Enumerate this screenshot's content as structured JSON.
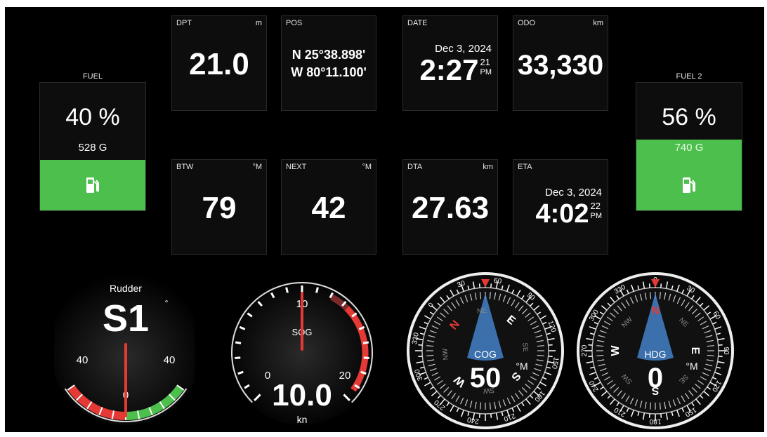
{
  "fuel1": {
    "title": "FUEL",
    "percent": "40 %",
    "gallons": "528 G",
    "level": 0.4
  },
  "fuel2": {
    "title": "FUEL 2",
    "percent": "56 %",
    "gallons": "740 G",
    "level": 0.56
  },
  "tiles": {
    "dpt": {
      "label": "DPT",
      "unit": "m",
      "value": "21.0"
    },
    "pos": {
      "label": "POS",
      "lat": "N 25°38.898'",
      "lon": "W 80°11.100'"
    },
    "date": {
      "label": "DATE",
      "date": "Dec 3, 2024",
      "time": "2:27",
      "sec": "21",
      "ampm": "PM"
    },
    "odo": {
      "label": "ODO",
      "unit": "km",
      "value": "33,330"
    },
    "btw": {
      "label": "BTW",
      "unit": "°M",
      "value": "79"
    },
    "next": {
      "label": "NEXT",
      "unit": "°M",
      "value": "42"
    },
    "dta": {
      "label": "DTA",
      "unit": "km",
      "value": "27.63"
    },
    "eta": {
      "label": "ETA",
      "date": "Dec 3, 2024",
      "time": "4:02",
      "sec": "22",
      "ampm": "PM"
    }
  },
  "rudder": {
    "title": "Rudder",
    "value": "S1",
    "unit": "°",
    "left_label": "40",
    "right_label": "40",
    "zero_label": "0",
    "angle": 1
  },
  "sog": {
    "title": "SOG",
    "value": "10.0",
    "unit": "kn",
    "ticks": [
      "0",
      "10",
      "20"
    ],
    "speed": 10
  },
  "cog": {
    "title": "COG",
    "value": "50",
    "unit": "°M",
    "ring_labels": [
      "0",
      "30",
      "60",
      "90",
      "120",
      "150",
      "180",
      "210",
      "240",
      "270",
      "300",
      "330"
    ],
    "cardinals": [
      "N",
      "E",
      "S",
      "W"
    ],
    "intercards": [
      "NE",
      "SE",
      "SW",
      "NW"
    ],
    "heading": 50
  },
  "hdg": {
    "title": "HDG",
    "value": "0",
    "unit": "°M",
    "ring_labels": [
      "0",
      "30",
      "60",
      "90",
      "120",
      "150",
      "180",
      "210",
      "240",
      "270",
      "300",
      "330"
    ],
    "cardinals": [
      "N",
      "E",
      "S",
      "W"
    ],
    "intercards": [
      "NE",
      "SE",
      "SW",
      "NW"
    ],
    "heading": 0
  },
  "colors": {
    "green": "#4cbf4c",
    "red": "#e53935",
    "accent_blue": "#4a90e2"
  },
  "icons": {
    "fuel": "fuel-pump-icon"
  }
}
